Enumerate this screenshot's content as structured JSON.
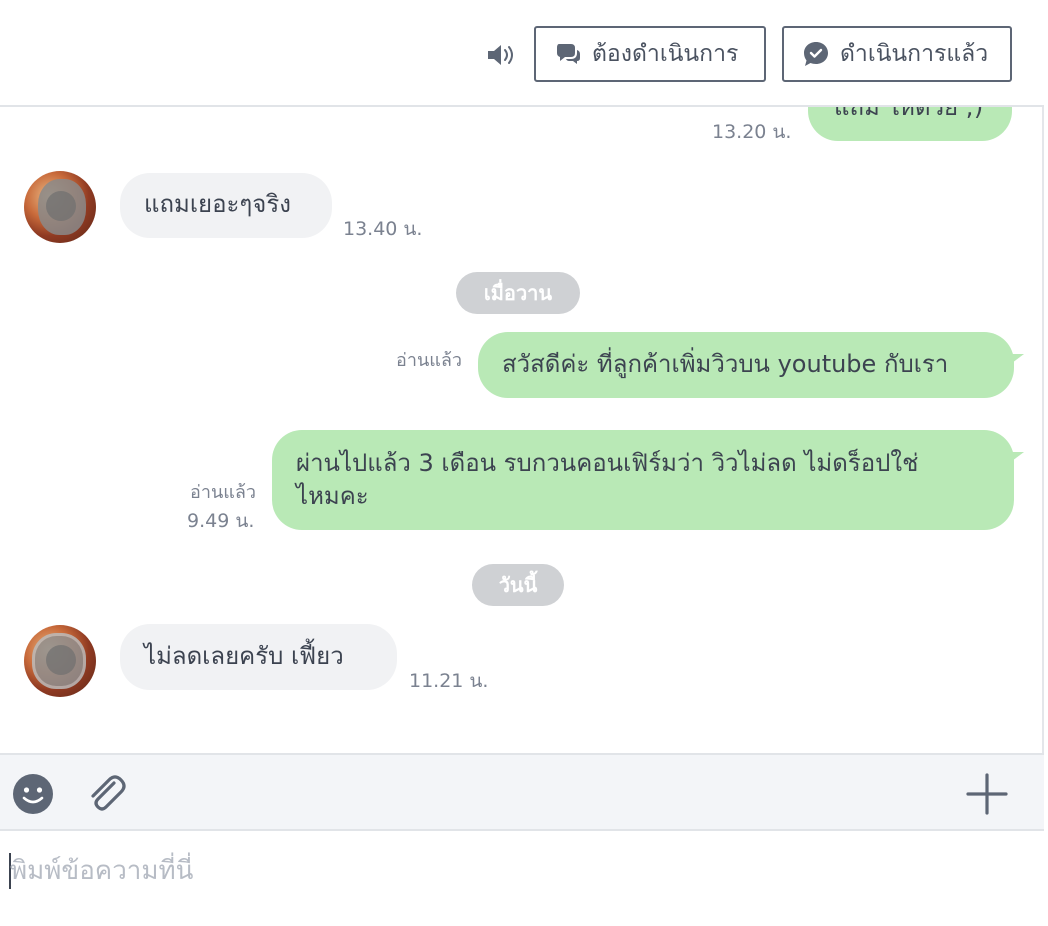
{
  "header": {
    "sound_icon": "speaker-icon",
    "todo_label": "ต้องดำเนินการ",
    "done_label": "ดำเนินการแล้ว"
  },
  "messages": {
    "prev_out": {
      "text": "แถม ให้ด้วย ;)",
      "time": "13.20 น."
    },
    "in_1": {
      "text": "แถมเยอะๆจริง",
      "time": "13.40 น."
    },
    "divider_yesterday": "เมื่อวาน",
    "out_1": {
      "text": "สวัสดีค่ะ ที่ลูกค้าเพิ่มวิวบน youtube กับเรา",
      "read": "อ่านแล้ว"
    },
    "out_2": {
      "text_line1": "ผ่านไปแล้ว 3 เดือน รบกวนคอนเฟิร์มว่า วิวไม่ลด ไม่ดร็อปใช่",
      "text_line2": "ไหมคะ",
      "read": "อ่านแล้ว",
      "time": "9.49 น."
    },
    "divider_today": "วันนี้",
    "in_2": {
      "text": "ไม่ลดเลยครับ  เฟี้ยว",
      "time": "11.21 น."
    }
  },
  "composer": {
    "placeholder": "พิมพ์ข้อความที่นี่",
    "value": ""
  },
  "colors": {
    "outgoing_bubble": "#b9e9b6",
    "incoming_bubble": "#f1f2f4",
    "divider_pill": "#cfd1d4"
  }
}
